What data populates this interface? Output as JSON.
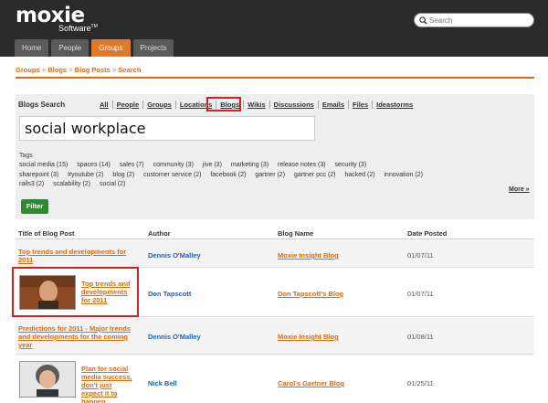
{
  "header": {
    "logo_main": "moxie",
    "logo_sub": "Software",
    "logo_tm": "TM",
    "search_placeholder": "Search",
    "tabs": [
      {
        "label": "Home"
      },
      {
        "label": "People"
      },
      {
        "label": "Groups"
      },
      {
        "label": "Projects"
      }
    ]
  },
  "breadcrumb": {
    "items": [
      "Groups",
      "Blogs",
      "Blog Posts",
      "Search"
    ],
    "separator": ">"
  },
  "search_panel": {
    "title": "Blogs Search",
    "filters": [
      "All",
      "People",
      "Groups",
      "Locations",
      "Blogs",
      "Wikis",
      "Discussions",
      "Emails",
      "Files",
      "Ideastorms"
    ],
    "query": "social workplace",
    "tags_label": "Tags",
    "tags": [
      "social media (15)",
      "spaces (14)",
      "sales (7)",
      "community (3)",
      "jive (3)",
      "marketing (3)",
      "release notes (3)",
      "security (3)",
      "sharepoint (3)",
      "#youtube (2)",
      "blog (2)",
      "customer service (2)",
      "facebook (2)",
      "gartner (2)",
      "gartner pcc (2)",
      "hacked (2)",
      "innovation (2)",
      "rails3 (2)",
      "scalability (2)",
      "social (2)"
    ],
    "more_label": "More »",
    "filter_button": "Filter"
  },
  "table": {
    "headers": [
      "Title of Blog Post",
      "Author",
      "Blog Name",
      "Date Posted"
    ],
    "rows": [
      {
        "title": "Top trends and developments for 2011",
        "author": "Dennis O'Malley",
        "blog": "Moxie Insight Blog",
        "date": "01/07/11"
      },
      {
        "title": "Top trends and developments for 2011",
        "author": "Don Tapscott",
        "blog": "Don Tapscott's Blog",
        "date": "01/07/11"
      },
      {
        "title": "Predictions for 2011 - Major trends and developments for the coming year",
        "author": "Dennis O'Malley",
        "blog": "Moxie Insight Blog",
        "date": "01/08/11"
      },
      {
        "title": "Plan for social media success, don't just expect it to happen",
        "author": "Nick Bell",
        "blog": "Carol's Gartner Blog",
        "date": "01/25/11"
      }
    ]
  },
  "colors": {
    "header_bg": "#2b2b2b",
    "accent_orange": "#d96a10",
    "active_tab": "#e07a2a",
    "link_blue": "#1f5fb0",
    "filter_green": "#2f8a2f",
    "highlight_red": "#d42020"
  }
}
